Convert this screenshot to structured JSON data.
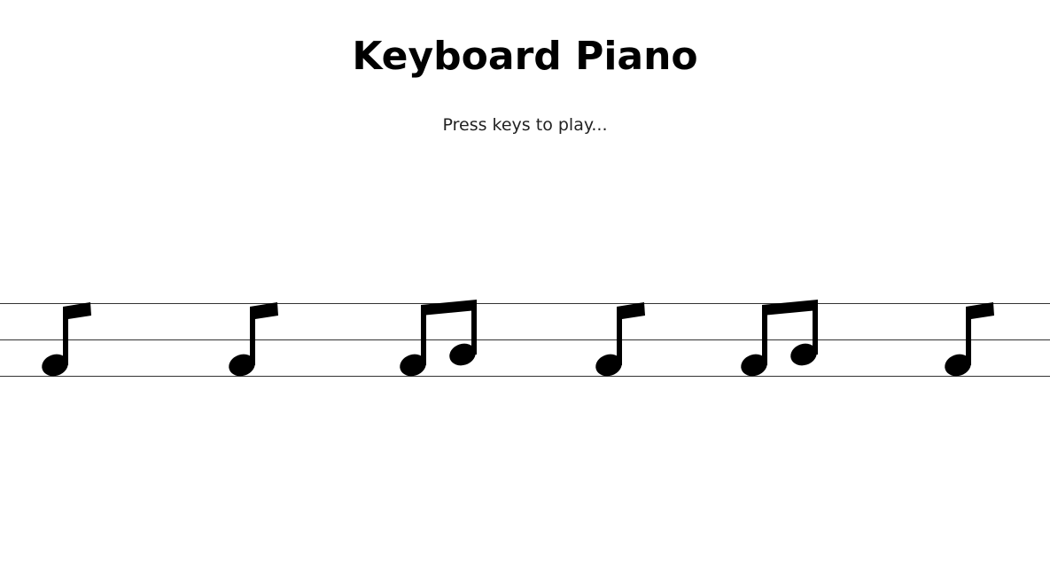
{
  "header": {
    "title": "Keyboard Piano",
    "hint": "Press keys to play..."
  },
  "staff": {
    "notes": [
      {
        "kind": "eighth-note",
        "icon": "eighth-note-icon"
      },
      {
        "kind": "eighth-note",
        "icon": "eighth-note-icon"
      },
      {
        "kind": "beamed-eighth-notes",
        "icon": "beamed-eighth-notes-icon"
      },
      {
        "kind": "eighth-note",
        "icon": "eighth-note-icon"
      },
      {
        "kind": "beamed-eighth-notes",
        "icon": "beamed-eighth-notes-icon"
      },
      {
        "kind": "eighth-note",
        "icon": "eighth-note-icon"
      }
    ]
  },
  "colors": {
    "text": "#000000",
    "note": "#000000",
    "staff_line": "#333333",
    "background": "#ffffff"
  }
}
